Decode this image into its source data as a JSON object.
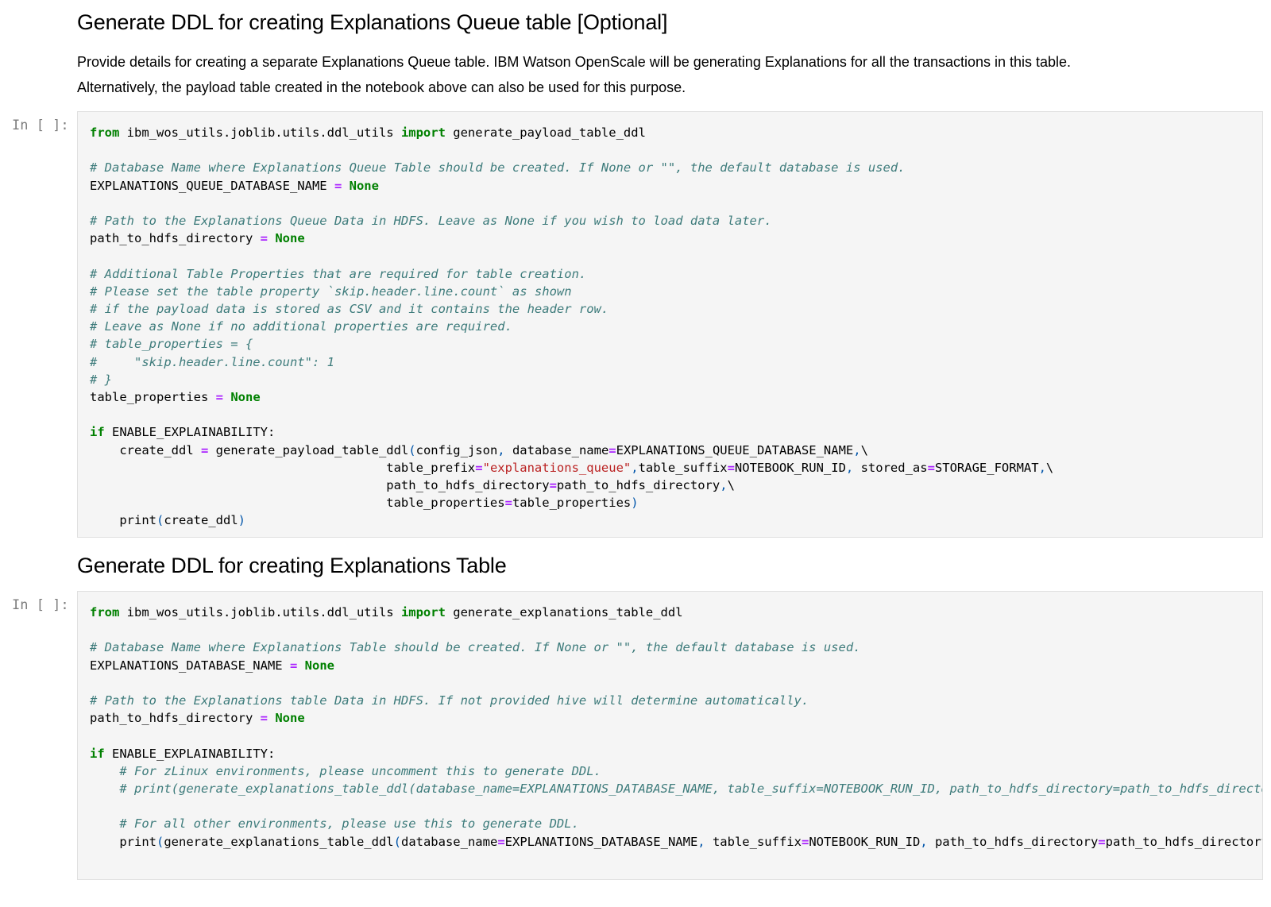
{
  "section1": {
    "heading": "Generate DDL for creating Explanations Queue table [Optional]",
    "para_line1": "Provide details for creating a separate Explanations Queue table. IBM Watson OpenScale will be generating Explanations for all the transactions in this table.",
    "para_line2": "Alternatively, the payload table created in the notebook above can also be used for this purpose.",
    "prompt": "In [ ]:"
  },
  "section2": {
    "heading": "Generate DDL for creating Explanations Table",
    "prompt": "In [ ]:"
  },
  "code1": [
    [
      [
        "kw",
        "from"
      ],
      [
        "t",
        " ibm_wos_utils.joblib.utils.ddl_utils "
      ],
      [
        "kw",
        "import"
      ],
      [
        "t",
        " generate_payload_table_ddl"
      ]
    ],
    [],
    [
      [
        "cm",
        "# Database Name where Explanations Queue Table should be created. If None or \"\", the default database is used."
      ]
    ],
    [
      [
        "t",
        "EXPLANATIONS_QUEUE_DATABASE_NAME "
      ],
      [
        "op",
        "="
      ],
      [
        "t",
        " "
      ],
      [
        "kw",
        "None"
      ]
    ],
    [],
    [
      [
        "cm",
        "# Path to the Explanations Queue Data in HDFS. Leave as None if you wish to load data later."
      ]
    ],
    [
      [
        "t",
        "path_to_hdfs_directory "
      ],
      [
        "op",
        "="
      ],
      [
        "t",
        " "
      ],
      [
        "kw",
        "None"
      ]
    ],
    [],
    [
      [
        "cm",
        "# Additional Table Properties that are required for table creation."
      ]
    ],
    [
      [
        "cm",
        "# Please set the table property `skip.header.line.count` as shown"
      ]
    ],
    [
      [
        "cm",
        "# if the payload data is stored as CSV and it contains the header row."
      ]
    ],
    [
      [
        "cm",
        "# Leave as None if no additional properties are required."
      ]
    ],
    [
      [
        "cm",
        "# table_properties = {"
      ]
    ],
    [
      [
        "cm",
        "#     \"skip.header.line.count\": 1"
      ]
    ],
    [
      [
        "cm",
        "# }"
      ]
    ],
    [
      [
        "t",
        "table_properties "
      ],
      [
        "op",
        "="
      ],
      [
        "t",
        " "
      ],
      [
        "kw",
        "None"
      ]
    ],
    [],
    [
      [
        "kw",
        "if"
      ],
      [
        "t",
        " ENABLE_EXPLAINABILITY:"
      ]
    ],
    [
      [
        "t",
        "    create_ddl "
      ],
      [
        "op",
        "="
      ],
      [
        "t",
        " generate_payload_table_ddl"
      ],
      [
        "pn",
        "("
      ],
      [
        "t",
        "config_json"
      ],
      [
        "pn",
        ","
      ],
      [
        "t",
        " database_name"
      ],
      [
        "op",
        "="
      ],
      [
        "t",
        "EXPLANATIONS_QUEUE_DATABASE_NAME"
      ],
      [
        "pn",
        ","
      ],
      [
        "t",
        "\\"
      ]
    ],
    [
      [
        "t",
        "                                        table_prefix"
      ],
      [
        "op",
        "="
      ],
      [
        "st",
        "\"explanations_queue\""
      ],
      [
        "pn",
        ","
      ],
      [
        "t",
        "table_suffix"
      ],
      [
        "op",
        "="
      ],
      [
        "t",
        "NOTEBOOK_RUN_ID"
      ],
      [
        "pn",
        ","
      ],
      [
        "t",
        " stored_as"
      ],
      [
        "op",
        "="
      ],
      [
        "t",
        "STORAGE_FORMAT"
      ],
      [
        "pn",
        ","
      ],
      [
        "t",
        "\\"
      ]
    ],
    [
      [
        "t",
        "                                        path_to_hdfs_directory"
      ],
      [
        "op",
        "="
      ],
      [
        "t",
        "path_to_hdfs_directory"
      ],
      [
        "pn",
        ","
      ],
      [
        "t",
        "\\"
      ]
    ],
    [
      [
        "t",
        "                                        table_properties"
      ],
      [
        "op",
        "="
      ],
      [
        "t",
        "table_properties"
      ],
      [
        "pn",
        ")"
      ]
    ],
    [
      [
        "t",
        "    print"
      ],
      [
        "pn",
        "("
      ],
      [
        "t",
        "create_ddl"
      ],
      [
        "pn",
        ")"
      ]
    ]
  ],
  "code2": [
    [
      [
        "kw",
        "from"
      ],
      [
        "t",
        " ibm_wos_utils.joblib.utils.ddl_utils "
      ],
      [
        "kw",
        "import"
      ],
      [
        "t",
        " generate_explanations_table_ddl"
      ]
    ],
    [],
    [
      [
        "cm",
        "# Database Name where Explanations Table should be created. If None or \"\", the default database is used."
      ]
    ],
    [
      [
        "t",
        "EXPLANATIONS_DATABASE_NAME "
      ],
      [
        "op",
        "="
      ],
      [
        "t",
        " "
      ],
      [
        "kw",
        "None"
      ]
    ],
    [],
    [
      [
        "cm",
        "# Path to the Explanations table Data in HDFS. If not provided hive will determine automatically."
      ]
    ],
    [
      [
        "t",
        "path_to_hdfs_directory "
      ],
      [
        "op",
        "="
      ],
      [
        "t",
        " "
      ],
      [
        "kw",
        "None"
      ]
    ],
    [],
    [
      [
        "kw",
        "if"
      ],
      [
        "t",
        " ENABLE_EXPLAINABILITY:"
      ]
    ],
    [
      [
        "cm",
        "    # For zLinux environments, please uncomment this to generate DDL."
      ]
    ],
    [
      [
        "cm",
        "    # print(generate_explanations_table_ddl(database_name=EXPLANATIONS_DATABASE_NAME, table_suffix=NOTEBOOK_RUN_ID, path_to_hdfs_directory=path_to_hdfs_directory))"
      ]
    ],
    [],
    [
      [
        "cm",
        "    # For all other environments, please use this to generate DDL."
      ]
    ],
    [
      [
        "t",
        "    print"
      ],
      [
        "pn",
        "("
      ],
      [
        "t",
        "generate_explanations_table_ddl"
      ],
      [
        "pn",
        "("
      ],
      [
        "t",
        "database_name"
      ],
      [
        "op",
        "="
      ],
      [
        "t",
        "EXPLANATIONS_DATABASE_NAME"
      ],
      [
        "pn",
        ","
      ],
      [
        "t",
        " table_suffix"
      ],
      [
        "op",
        "="
      ],
      [
        "t",
        "NOTEBOOK_RUN_ID"
      ],
      [
        "pn",
        ","
      ],
      [
        "t",
        " path_to_hdfs_directory"
      ],
      [
        "op",
        "="
      ],
      [
        "t",
        "path_to_hdfs_directory"
      ],
      [
        "pn",
        "))"
      ]
    ]
  ]
}
